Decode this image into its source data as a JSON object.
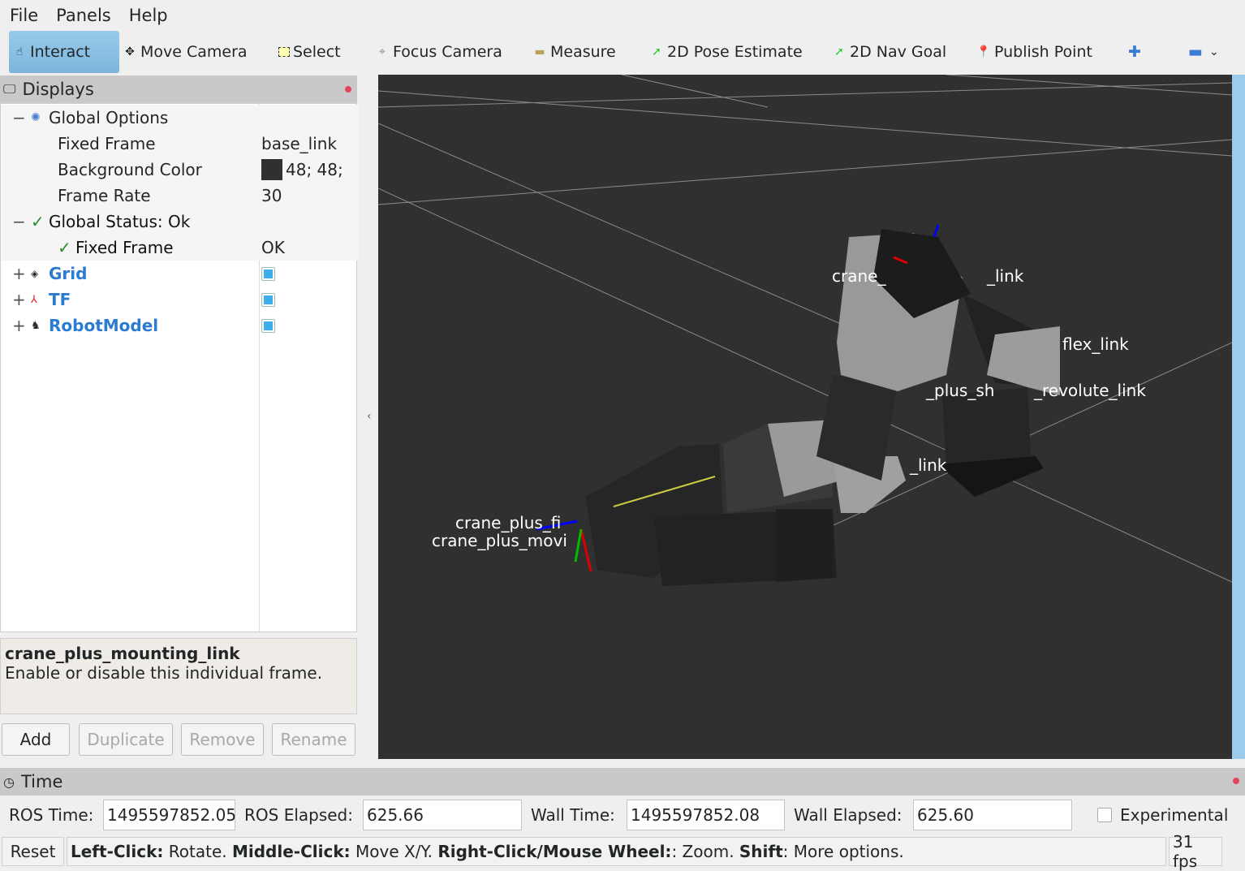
{
  "menu": {
    "file": "File",
    "panels": "Panels",
    "help": "Help"
  },
  "toolbar": {
    "interact": "Interact",
    "move_camera": "Move Camera",
    "select": "Select",
    "focus_camera": "Focus Camera",
    "measure": "Measure",
    "pose_estimate": "2D Pose Estimate",
    "nav_goal": "2D Nav Goal",
    "publish_point": "Publish Point"
  },
  "displays": {
    "title": "Displays",
    "global_options": "Global Options",
    "fixed_frame_label": "Fixed Frame",
    "fixed_frame_value": "base_link",
    "bg_color_label": "Background Color",
    "bg_color_value": "48; 48;",
    "bg_color_swatch": "#303030",
    "frame_rate_label": "Frame Rate",
    "frame_rate_value": "30",
    "global_status": "Global Status: Ok",
    "status_fixed_frame": "Fixed Frame",
    "status_fixed_frame_value": "OK",
    "items": [
      {
        "label": "Grid",
        "enabled": true
      },
      {
        "label": "TF",
        "enabled": true
      },
      {
        "label": "RobotModel",
        "enabled": true
      }
    ]
  },
  "description": {
    "title": "crane_plus_mounting_link",
    "text": "Enable or disable this individual frame."
  },
  "buttons": {
    "add": "Add",
    "duplicate": "Duplicate",
    "remove": "Remove",
    "rename": "Rename"
  },
  "viewport": {
    "labels": [
      "crane_",
      "_link",
      "flex_link",
      "_plus_sh",
      "_revolute_link",
      "_link",
      "crane_plus_fi",
      "crane_plus_movi"
    ]
  },
  "time": {
    "title": "Time",
    "ros_time_label": "ROS Time:",
    "ros_time": "1495597852.05",
    "ros_elapsed_label": "ROS Elapsed:",
    "ros_elapsed": "625.66",
    "wall_time_label": "Wall Time:",
    "wall_time": "1495597852.08",
    "wall_elapsed_label": "Wall Elapsed:",
    "wall_elapsed": "625.60",
    "experimental": "Experimental"
  },
  "statusbar": {
    "reset": "Reset",
    "hint_b1": "Left-Click:",
    "hint_t1": " Rotate. ",
    "hint_b2": "Middle-Click:",
    "hint_t2": " Move X/Y. ",
    "hint_b3": "Right-Click/Mouse Wheel:",
    "hint_t3": ": Zoom. ",
    "hint_b4": "Shift",
    "hint_t4": ": More options.",
    "fps": "31 fps"
  }
}
